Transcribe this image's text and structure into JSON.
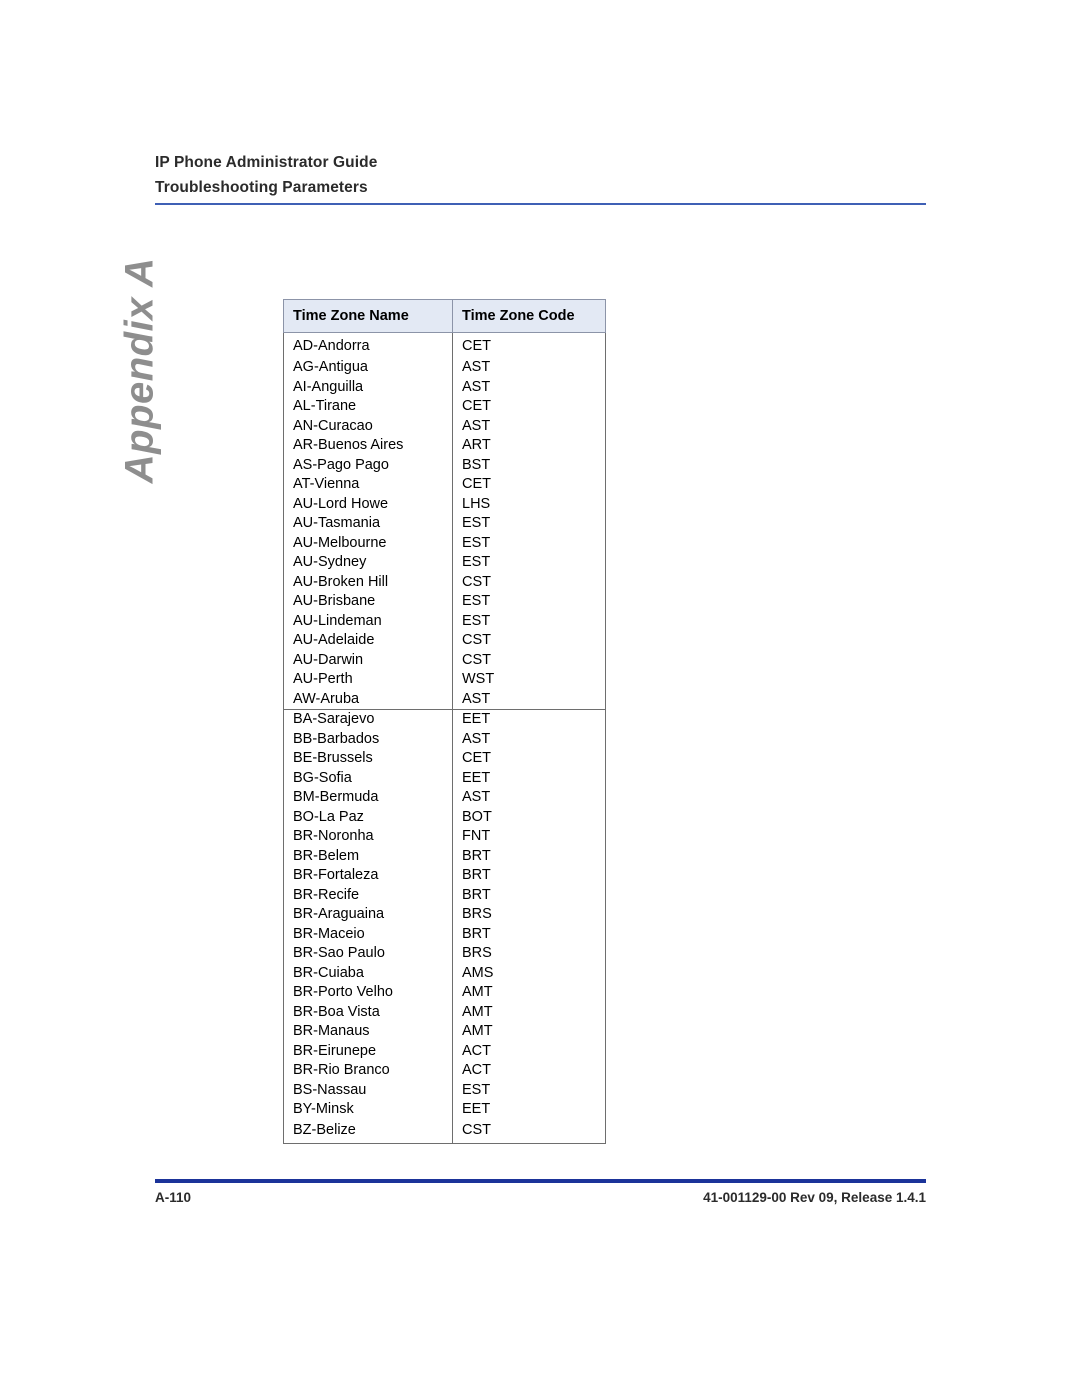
{
  "document": {
    "header": {
      "title": "IP Phone Administrator Guide",
      "subtitle": "Troubleshooting Parameters",
      "rule_color": "#3F60B5"
    },
    "appendix_tab": {
      "label": "Appendix A",
      "color": "#8E8E8E"
    },
    "footer": {
      "page_number": "A-110",
      "doc_reference": "41-001129-00 Rev 09, Release 1.4.1",
      "rule_color": "#1B3399"
    }
  },
  "table": {
    "header_fill": "#E3E9F4",
    "border_color": "#6E6E6E",
    "columns": [
      {
        "key": "name",
        "label": "Time Zone Name"
      },
      {
        "key": "code",
        "label": "Time Zone Code"
      }
    ],
    "groups": [
      {
        "letter": "A",
        "rows": [
          {
            "name": "AD-Andorra",
            "code": "CET"
          },
          {
            "name": "AG-Antigua",
            "code": "AST"
          },
          {
            "name": "AI-Anguilla",
            "code": "AST"
          },
          {
            "name": "AL-Tirane",
            "code": "CET"
          },
          {
            "name": "AN-Curacao",
            "code": "AST"
          },
          {
            "name": "AR-Buenos Aires",
            "code": "ART"
          },
          {
            "name": "AS-Pago Pago",
            "code": "BST"
          },
          {
            "name": "AT-Vienna",
            "code": "CET"
          },
          {
            "name": "AU-Lord Howe",
            "code": "LHS"
          },
          {
            "name": "AU-Tasmania",
            "code": "EST"
          },
          {
            "name": "AU-Melbourne",
            "code": "EST"
          },
          {
            "name": "AU-Sydney",
            "code": "EST"
          },
          {
            "name": "AU-Broken Hill",
            "code": "CST"
          },
          {
            "name": "AU-Brisbane",
            "code": "EST"
          },
          {
            "name": "AU-Lindeman",
            "code": "EST"
          },
          {
            "name": "AU-Adelaide",
            "code": "CST"
          },
          {
            "name": "AU-Darwin",
            "code": "CST"
          },
          {
            "name": "AU-Perth",
            "code": "WST"
          },
          {
            "name": "AW-Aruba",
            "code": "AST"
          }
        ]
      },
      {
        "letter": "B",
        "rows": [
          {
            "name": "BA-Sarajevo",
            "code": "EET"
          },
          {
            "name": "BB-Barbados",
            "code": "AST"
          },
          {
            "name": "BE-Brussels",
            "code": "CET"
          },
          {
            "name": "BG-Sofia",
            "code": "EET"
          },
          {
            "name": "BM-Bermuda",
            "code": "AST"
          },
          {
            "name": "BO-La Paz",
            "code": "BOT"
          },
          {
            "name": "BR-Noronha",
            "code": "FNT"
          },
          {
            "name": "BR-Belem",
            "code": "BRT"
          },
          {
            "name": "BR-Fortaleza",
            "code": "BRT"
          },
          {
            "name": "BR-Recife",
            "code": "BRT"
          },
          {
            "name": "BR-Araguaina",
            "code": "BRS"
          },
          {
            "name": "BR-Maceio",
            "code": "BRT"
          },
          {
            "name": "BR-Sao Paulo",
            "code": "BRS"
          },
          {
            "name": "BR-Cuiaba",
            "code": "AMS"
          },
          {
            "name": "BR-Porto Velho",
            "code": "AMT"
          },
          {
            "name": "BR-Boa Vista",
            "code": "AMT"
          },
          {
            "name": "BR-Manaus",
            "code": "AMT"
          },
          {
            "name": "BR-Eirunepe",
            "code": "ACT"
          },
          {
            "name": "BR-Rio Branco",
            "code": "ACT"
          },
          {
            "name": "BS-Nassau",
            "code": "EST"
          },
          {
            "name": "BY-Minsk",
            "code": "EET"
          },
          {
            "name": "BZ-Belize",
            "code": "CST"
          }
        ]
      }
    ]
  }
}
